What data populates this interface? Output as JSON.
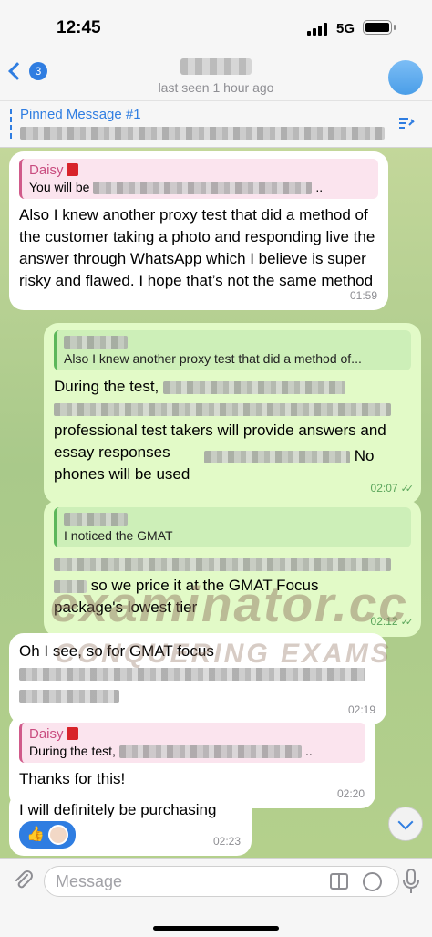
{
  "status_bar": {
    "time": "12:45",
    "network": "5G"
  },
  "nav": {
    "back_count": "3",
    "last_seen": "last seen 1 hour ago"
  },
  "pinned": {
    "title": "Pinned Message #1"
  },
  "messages": [
    {
      "reply_name": "Daisy",
      "reply_text_start": "You will be",
      "reply_text_end": "..",
      "text": "Also I knew another proxy test that did a method of the customer taking a photo and responding live the answer through WhatsApp which I believe is super risky and flawed. I hope that’s not the same method",
      "time": "01:59"
    },
    {
      "reply_text": "Also I knew another proxy test that did a method of...",
      "text_1": "During the test,",
      "text_2": "professional test takers will provide answers and essay responses",
      "text_3": "No",
      "text_4": "phones will be used",
      "time": "02:07"
    },
    {
      "reply_text": "I noticed the GMAT",
      "text_1": "so we price it at the GMAT Focus",
      "text_2": "package's lowest tier",
      "time": "02:12"
    },
    {
      "text": "Oh I see, so for GMAT focus",
      "time": "02:19"
    },
    {
      "reply_name": "Daisy",
      "reply_text_start": "During the test,",
      "reply_text_end": "..",
      "text": "Thanks for this!",
      "time": "02:20"
    },
    {
      "text": "I will definitely be purchasing",
      "reaction": "👍",
      "time": "02:23"
    }
  ],
  "watermark": {
    "line1": "examinator.cc",
    "line2": "CONQUERING EXAMS"
  },
  "input": {
    "placeholder": "Message"
  }
}
